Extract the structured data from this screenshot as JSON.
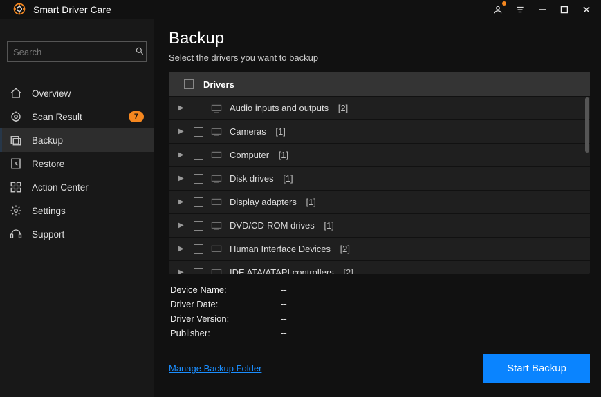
{
  "app": {
    "title": "Smart Driver Care"
  },
  "search": {
    "placeholder": "Search"
  },
  "sidebar": {
    "items": [
      {
        "label": "Overview",
        "id": "overview",
        "badge": null
      },
      {
        "label": "Scan Result",
        "id": "scan-result",
        "badge": "7"
      },
      {
        "label": "Backup",
        "id": "backup",
        "badge": null
      },
      {
        "label": "Restore",
        "id": "restore",
        "badge": null
      },
      {
        "label": "Action Center",
        "id": "action-center",
        "badge": null
      },
      {
        "label": "Settings",
        "id": "settings",
        "badge": null
      },
      {
        "label": "Support",
        "id": "support",
        "badge": null
      }
    ],
    "active_index": 2
  },
  "page": {
    "title": "Backup",
    "subtitle": "Select the drivers you want to backup"
  },
  "drivers": {
    "header": "Drivers",
    "categories": [
      {
        "name": "Audio inputs and outputs",
        "count": 2
      },
      {
        "name": "Cameras",
        "count": 1
      },
      {
        "name": "Computer",
        "count": 1
      },
      {
        "name": "Disk drives",
        "count": 1
      },
      {
        "name": "Display adapters",
        "count": 1
      },
      {
        "name": "DVD/CD-ROM drives",
        "count": 1
      },
      {
        "name": "Human Interface Devices",
        "count": 2
      },
      {
        "name": "IDE ATA/ATAPI controllers",
        "count": 2
      }
    ]
  },
  "details": {
    "rows": [
      {
        "label": "Device Name:",
        "value": "--"
      },
      {
        "label": "Driver Date:",
        "value": "--"
      },
      {
        "label": "Driver Version:",
        "value": "--"
      },
      {
        "label": "Publisher:",
        "value": "--"
      }
    ]
  },
  "footer": {
    "manage_label": "Manage Backup Folder",
    "start_label": "Start Backup"
  }
}
